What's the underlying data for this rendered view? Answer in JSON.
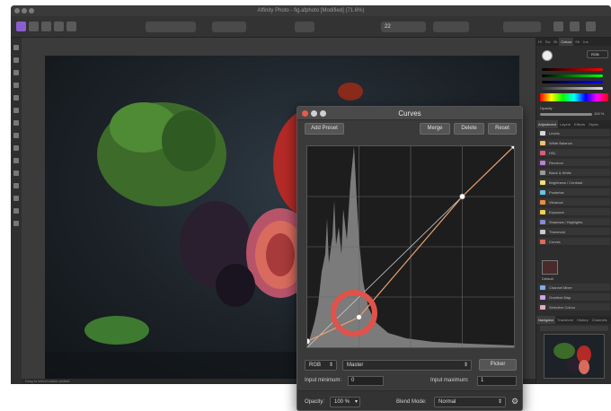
{
  "window": {
    "title": "Affinity Photo - fig.afphoto [Modified] (71.6%)"
  },
  "toolbar": {
    "zoom_value": "22",
    "icons": [
      "persona-photo-icon",
      "persona-liquify-icon",
      "persona-develop-icon",
      "persona-tone-icon",
      "persona-export-icon",
      "share-icon",
      "adjust-icon",
      "snapping-icon",
      "selection-icon"
    ]
  },
  "tools": [
    "move-icon",
    "crop-icon",
    "brush-icon",
    "eraser-icon",
    "fill-icon",
    "gradient-icon",
    "selection-brush-icon",
    "marquee-icon",
    "clone-icon",
    "dodge-icon",
    "text-icon",
    "shape-icon",
    "zoom-icon",
    "hand-icon",
    "color-icon"
  ],
  "statusbar": {
    "text": "Drag to select colour picked"
  },
  "right_panel": {
    "top_tabs": [
      "Hi",
      "Sw",
      "Br",
      "Colour",
      "Str",
      "Ins"
    ],
    "mode": "RGB",
    "opacity_label": "Opacity",
    "opacity_value": "100 %",
    "tabs": [
      "Adjustment",
      "Layers",
      "Effects",
      "Styles",
      "Stock"
    ],
    "adjustments": [
      {
        "label": "Levels",
        "color": "#d8d8d8"
      },
      {
        "label": "White Balance",
        "color": "#f0c36a"
      },
      {
        "label": "HSL",
        "color": "#e05a7a"
      },
      {
        "label": "Recolour",
        "color": "#c07cd6"
      },
      {
        "label": "Black & White",
        "color": "#9a9a9a"
      },
      {
        "label": "Brightness / Contrast",
        "color": "#f2e46e"
      },
      {
        "label": "Posterise",
        "color": "#6ac7e3"
      },
      {
        "label": "Vibrance",
        "color": "#f08c3a"
      },
      {
        "label": "Exposure",
        "color": "#f5d14a"
      },
      {
        "label": "Shadows / Highlights",
        "color": "#8a8ad8"
      },
      {
        "label": "Threshold",
        "color": "#cccccc"
      },
      {
        "label": "Curves",
        "color": "#e06a5a"
      }
    ],
    "preset_label": "Default",
    "more_adjustments": [
      {
        "label": "Channel Mixer",
        "color": "#7ab0e8"
      },
      {
        "label": "Gradient Map",
        "color": "#c9a6ef"
      },
      {
        "label": "Selective Colour",
        "color": "#e9a8c6"
      }
    ],
    "nav_tabs": [
      "Navigator",
      "Transform",
      "History",
      "Channels"
    ]
  },
  "curves_dialog": {
    "title": "Curves",
    "add_preset": "Add Preset",
    "merge": "Merge",
    "delete": "Delete",
    "reset": "Reset",
    "channel_mode": "RGB",
    "channel": "Master",
    "picker": "Picker",
    "input_min_label": "Input minimum:",
    "input_min_value": "0",
    "input_max_label": "Input maximum:",
    "input_max_value": "1",
    "opacity_label": "Opacity:",
    "opacity_value": "100 %",
    "blend_label": "Blend Mode:",
    "blend_value": "Normal",
    "curve_points": [
      [
        0,
        0.03
      ],
      [
        0.25,
        0.15
      ],
      [
        0.75,
        0.75
      ],
      [
        1,
        1
      ]
    ]
  },
  "colors": {
    "accent_highlight": "#e0524a",
    "curve": "#e8a070"
  }
}
